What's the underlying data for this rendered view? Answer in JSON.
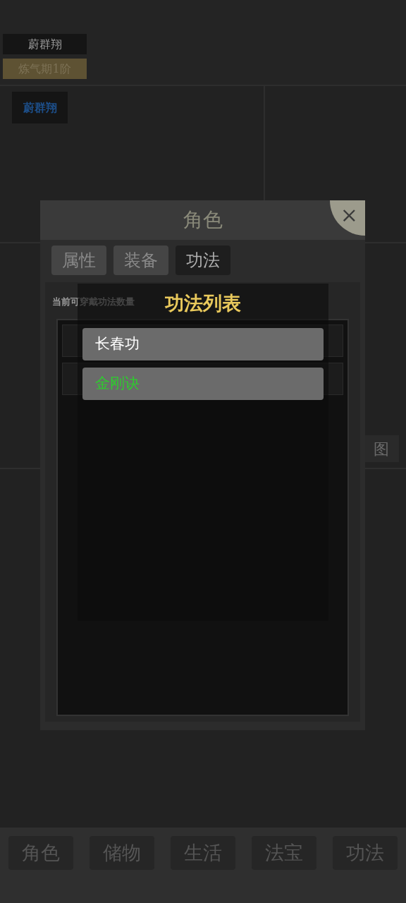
{
  "player": {
    "name": "蔚群翔",
    "realm": "炼气期1阶"
  },
  "team_slot": {
    "name": "蔚群翔"
  },
  "map_button": {
    "label": "图"
  },
  "modal": {
    "title": "角色",
    "close": "×",
    "tabs": [
      {
        "label": "属性",
        "selected": false
      },
      {
        "label": "装备",
        "selected": false
      },
      {
        "label": "功法",
        "selected": true
      }
    ],
    "capacity_text": "当前可穿戴功法数量"
  },
  "popup": {
    "title": "功法列表",
    "items": [
      {
        "label": "长春功",
        "kind": "common"
      },
      {
        "label": "金刚诀",
        "kind": "rare"
      }
    ]
  },
  "bottom_nav": [
    {
      "label": "角色"
    },
    {
      "label": "储物"
    },
    {
      "label": "生活"
    },
    {
      "label": "法宝"
    },
    {
      "label": "功法"
    }
  ]
}
